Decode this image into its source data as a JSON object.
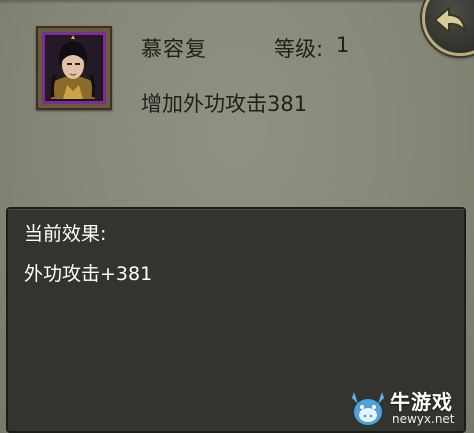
{
  "hero": {
    "name": "慕容复",
    "level_label": "等级:",
    "level_value": "1",
    "bonus_text": "增加外功攻击381"
  },
  "effect": {
    "title": "当前效果:",
    "value": "外功攻击+381"
  },
  "watermark": {
    "brand": "牛游戏",
    "site": "newyx.net"
  },
  "colors": {
    "panel_bg": "#858878",
    "effect_box_bg": "#33342e",
    "portrait_border": "#7a2d9a",
    "effect_text": "#ffffff"
  },
  "icons": {
    "back": "back-arrow-icon",
    "portrait": "hero-portrait",
    "watermark_logo": "bull-logo-icon"
  }
}
